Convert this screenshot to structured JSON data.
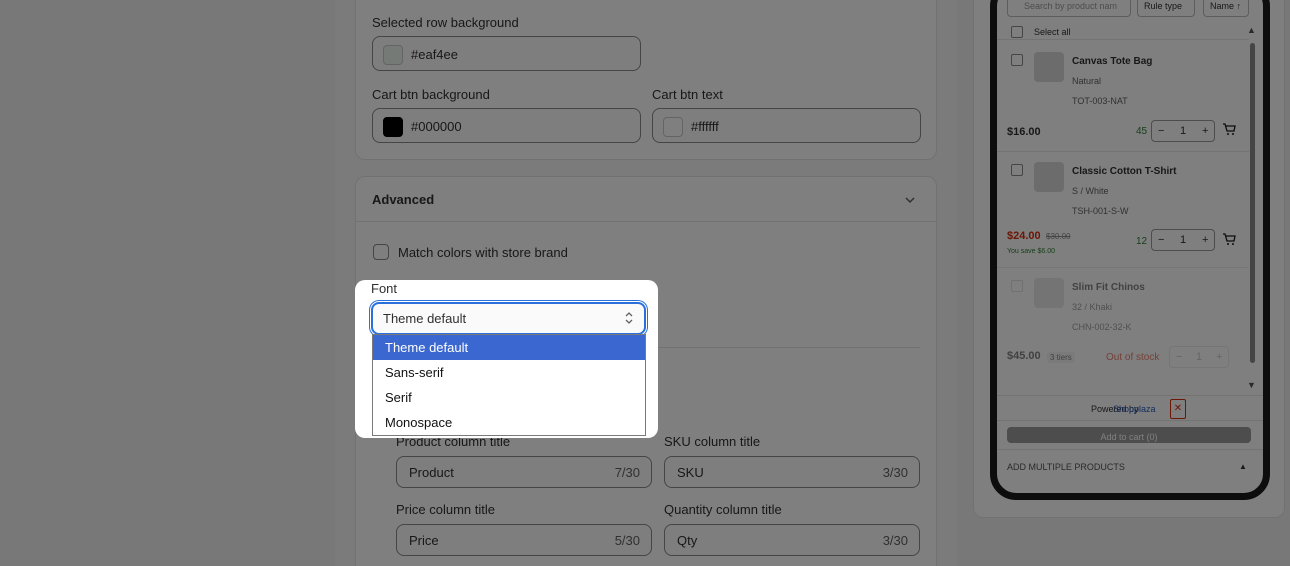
{
  "colors": {
    "selected_row_swatch": "#eaf4ee",
    "cart_btn_bg_swatch": "#000000",
    "cart_btn_text_swatch": "#ffffff",
    "accent": "#3b67d1",
    "price_sale": "#d82c0d",
    "stock_green": "#2e7d32"
  },
  "colors_section": {
    "selected_row_bg_label": "Selected row background",
    "selected_row_bg_value": "#eaf4ee",
    "cart_btn_bg_label": "Cart btn background",
    "cart_btn_bg_value": "#000000",
    "cart_btn_text_label": "Cart btn text",
    "cart_btn_text_value": "#ffffff"
  },
  "advanced": {
    "title": "Advanced",
    "match_colors_label": "Match colors with store brand",
    "font_label": "Font",
    "font_selected": "Theme default",
    "font_options": [
      "Theme default",
      "Sans-serif",
      "Serif",
      "Monospace"
    ]
  },
  "columns": {
    "product_label": "Product column title",
    "product_value": "Product",
    "product_count": "7/30",
    "sku_label": "SKU column title",
    "sku_value": "SKU",
    "sku_count": "3/30",
    "price_label": "Price column title",
    "price_value": "Price",
    "price_count": "5/30",
    "qty_label": "Quantity column title",
    "qty_value": "Qty",
    "qty_count": "3/30"
  },
  "preview": {
    "search_placeholder": "Search by product nam",
    "rule_type": "Rule type",
    "sort": "Name ↑",
    "select_all": "Select all",
    "products": [
      {
        "name": "Canvas Tote Bag",
        "variant": "Natural",
        "sku": "TOT-003-NAT",
        "price": "$16.00",
        "stock": "45",
        "qty": "1"
      },
      {
        "name": "Classic Cotton T-Shirt",
        "variant": "S / White",
        "sku": "TSH-001-S-W",
        "price": "$24.00",
        "compare": "$30.00",
        "save": "You save $6.00",
        "stock": "12",
        "qty": "1"
      },
      {
        "name": "Slim Fit Chinos",
        "variant": "32 / Khaki",
        "sku": "CHN-002-32-K",
        "price": "$45.00",
        "tiers": "3 tiers",
        "stock_status": "Out of stock",
        "qty": "1"
      }
    ],
    "powered_by": "Powered by",
    "brand": "Shopplaza",
    "add_to_cart": "Add to cart (0)",
    "add_multiple": "ADD MULTIPLE PRODUCTS"
  }
}
